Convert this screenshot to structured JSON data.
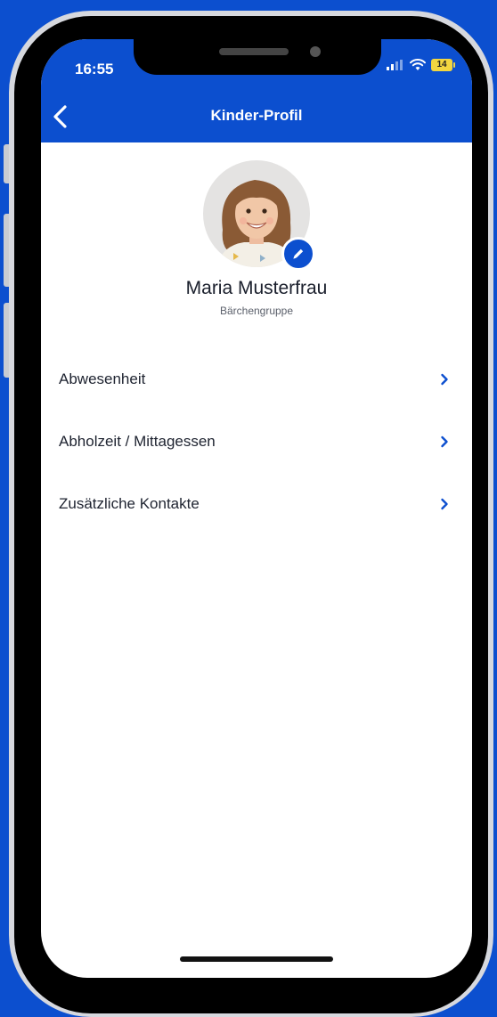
{
  "status_bar": {
    "time": "16:55",
    "battery": "14"
  },
  "header": {
    "title": "Kinder-Profil",
    "back_icon": "chevron-left-icon",
    "color": "#0c4fcf"
  },
  "profile": {
    "name": "Maria Musterfrau",
    "group": "Bärchengruppe",
    "edit_icon": "pencil-icon"
  },
  "menu": {
    "items": [
      {
        "label": "Abwesenheit",
        "icon": "chevron-right-icon"
      },
      {
        "label": "Abholzeit / Mittagessen",
        "icon": "chevron-right-icon"
      },
      {
        "label": "Zusätzliche Kontakte",
        "icon": "chevron-right-icon"
      }
    ]
  },
  "colors": {
    "accent": "#0c4fcf",
    "background": "#ffffff",
    "text": "#1e2330"
  }
}
